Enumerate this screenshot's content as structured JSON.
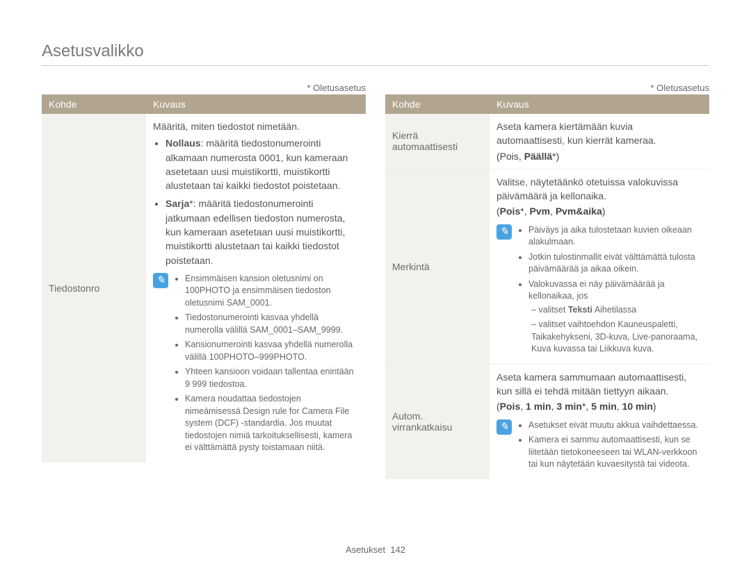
{
  "page_title": "Asetusvalikko",
  "default_note": "* Oletusasetus",
  "footer_label": "Asetukset",
  "footer_page": "142",
  "left": {
    "header_kohde": "Kohde",
    "header_kuvaus": "Kuvaus",
    "row_label": "Tiedostonro",
    "intro": "Määritä, miten tiedostot nimetään.",
    "bullet1_bold": "Nollaus",
    "bullet1_text": ": määritä tiedostonumerointi alkamaan numerosta 0001, kun kameraan asetetaan uusi muistikortti, muistikortti alustetaan tai kaikki tiedostot poistetaan.",
    "bullet2_bold": "Sarja",
    "bullet2_star": "*",
    "bullet2_text": ": määritä tiedostonumerointi jatkumaan edellisen tiedoston numerosta, kun kameraan asetetaan uusi muistikortti, muistikortti alustetaan tai kaikki tiedostot poistetaan.",
    "notes": [
      "Ensimmäisen kansion oletusnimi on 100PHOTO ja ensimmäisen tiedoston oletusnimi SAM_0001.",
      "Tiedostonumerointi kasvaa yhdellä numerolla välillä SAM_0001–SAM_9999.",
      "Kansionumerointi kasvaa yhdellä numerolla välillä 100PHOTO–999PHOTO.",
      "Yhteen kansioon voidaan tallentaa enintään 9 999 tiedostoa.",
      "Kamera noudattaa tiedostojen nimeämisessä Design rule for Camera File system (DCF) -standardia. Jos muutat tiedostojen nimiä tarkoituksellisesti, kamera ei välttämättä pysty toistamaan niitä."
    ]
  },
  "right": {
    "header_kohde": "Kohde",
    "header_kuvaus": "Kuvaus",
    "row1_label": "Kierrä automaattisesti",
    "row1_text": "Aseta kamera kiertämään kuvia automaattisesti, kun kierrät kameraa.",
    "row1_options": "(Pois, Päällä*)",
    "row2_label": "Merkintä",
    "row2_text": "Valitse, näytetäänkö otetuissa valokuvissa päivämäärä ja kellonaika.",
    "row2_options": "(Pois*, Pvm, Pvm&aika)",
    "row2_notes": [
      "Päiväys ja aika tulostetaan kuvien oikeaan alakulmaan.",
      "Jotkin tulostinmallit eivät välttämättä tulosta päivämäärää ja aikaa oikein.",
      "Valokuvassa ei näy päivämäärää ja kellonaikaa, jos"
    ],
    "row2_sub": [
      "valitset Teksti Aihetilassa",
      "valitset vaihtoehdon Kauneuspaletti, Taikakehykseni, 3D-kuva, Live-panoraama, Kuva kuvassa tai Liikkuva kuva."
    ],
    "row2_sub_bold": "Teksti",
    "row3_label": "Autom. virrankatkaisu",
    "row3_text": "Aseta kamera sammumaan automaattisesti, kun sillä ei tehdä mitään tiettyyn aikaan.",
    "row3_options": "(Pois, 1 min, 3 min*, 5 min, 10 min)",
    "row3_notes": [
      "Asetukset eivät muutu akkua vaihdettaessa.",
      "Kamera ei sammu automaattisesti, kun se liitetään tietokoneeseen tai WLAN-verkkoon tai kun näytetään kuvaesitystä tai videota."
    ]
  }
}
